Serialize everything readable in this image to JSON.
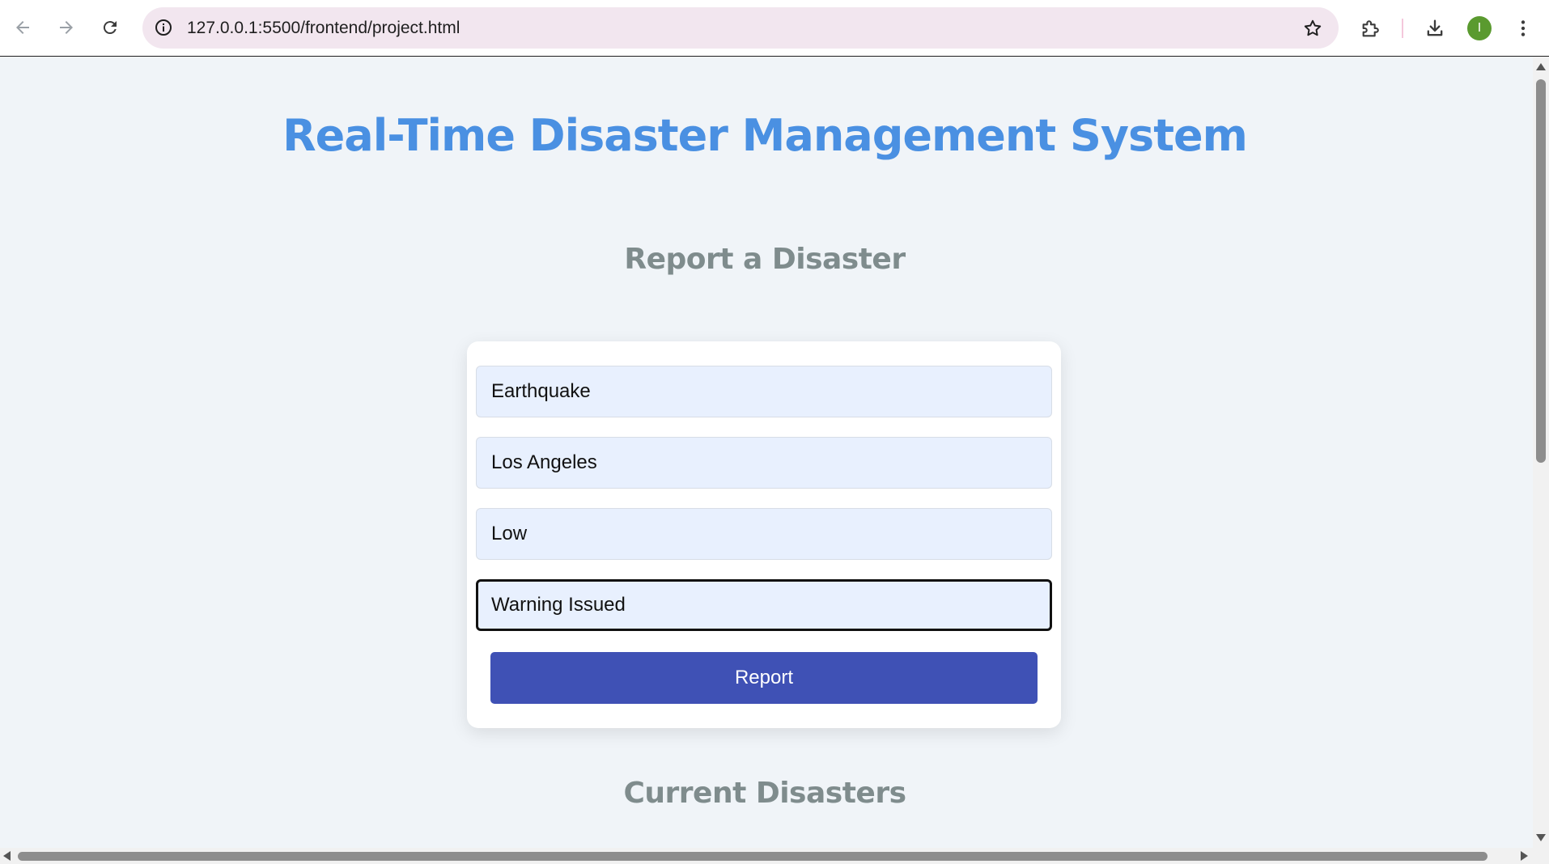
{
  "browser": {
    "url": "127.0.0.1:5500/frontend/project.html",
    "profile_initial": "I",
    "icons": {
      "back": "arrow-left-icon",
      "forward": "arrow-right-icon",
      "reload": "reload-icon",
      "info": "info-icon",
      "bookmark": "star-icon",
      "extensions": "puzzle-icon",
      "downloads": "download-icon",
      "menu": "kebab-menu-icon"
    },
    "colors": {
      "omnibox_bg": "#f2e6ef",
      "avatar_bg": "#5a9a2f"
    }
  },
  "page": {
    "title": "Real-Time Disaster Management System",
    "report_section_title": "Report a Disaster",
    "current_section_title": "Current Disasters",
    "colors": {
      "title": "#4a90e2",
      "section_title": "#7f8c8d",
      "button": "#3f51b5",
      "field_bg": "#e8f0fe",
      "page_bg": "#f0f4f8"
    }
  },
  "form": {
    "type_value": "Earthquake",
    "location_value": "Los Angeles",
    "severity_value": "Low",
    "status_value": "Warning Issued",
    "submit_label": "Report"
  }
}
